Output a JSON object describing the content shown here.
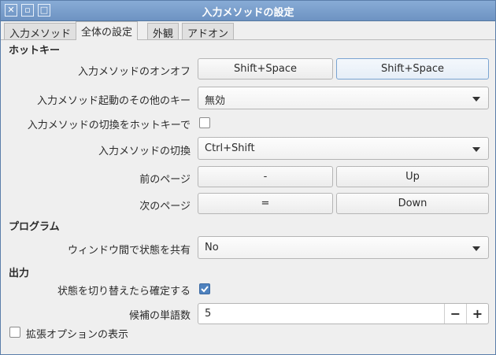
{
  "window": {
    "title": "入力メソッドの設定",
    "buttons": {
      "close": "✕",
      "minimize": "▫",
      "maximize": "□"
    }
  },
  "tabs": [
    {
      "label": "入力メソッド",
      "active": false
    },
    {
      "label": "全体の設定",
      "active": true
    },
    {
      "label": "外観",
      "active": false
    },
    {
      "label": "アドオン",
      "active": false
    }
  ],
  "sections": {
    "hotkey": "ホットキー",
    "program": "プログラム",
    "output": "出力"
  },
  "hotkey": {
    "toggle_label": "入力メソッドのオンオフ",
    "toggle_key1": "Shift+Space",
    "toggle_key2": "Shift+Space",
    "extra_label": "入力メソッド起動のその他のキー",
    "extra_value": "無効",
    "switch_hotkey_label": "入力メソッドの切換をホットキーで",
    "switch_hotkey_checked": false,
    "switch_label": "入力メソッドの切換",
    "switch_value": "Ctrl+Shift",
    "prev_page_label": "前のページ",
    "prev_key1": "-",
    "prev_key2": "Up",
    "next_page_label": "次のページ",
    "next_key1": "=",
    "next_key2": "Down"
  },
  "program": {
    "share_state_label": "ウィンドウ間で状態を共有",
    "share_state_value": "No"
  },
  "output": {
    "commit_label": "状態を切り替えたら確定する",
    "commit_checked": true,
    "candidates_label": "候補の単語数",
    "candidates_value": "5",
    "minus": "−",
    "plus": "+"
  },
  "advanced_label": "拡張オプションの表示",
  "advanced_checked": false
}
